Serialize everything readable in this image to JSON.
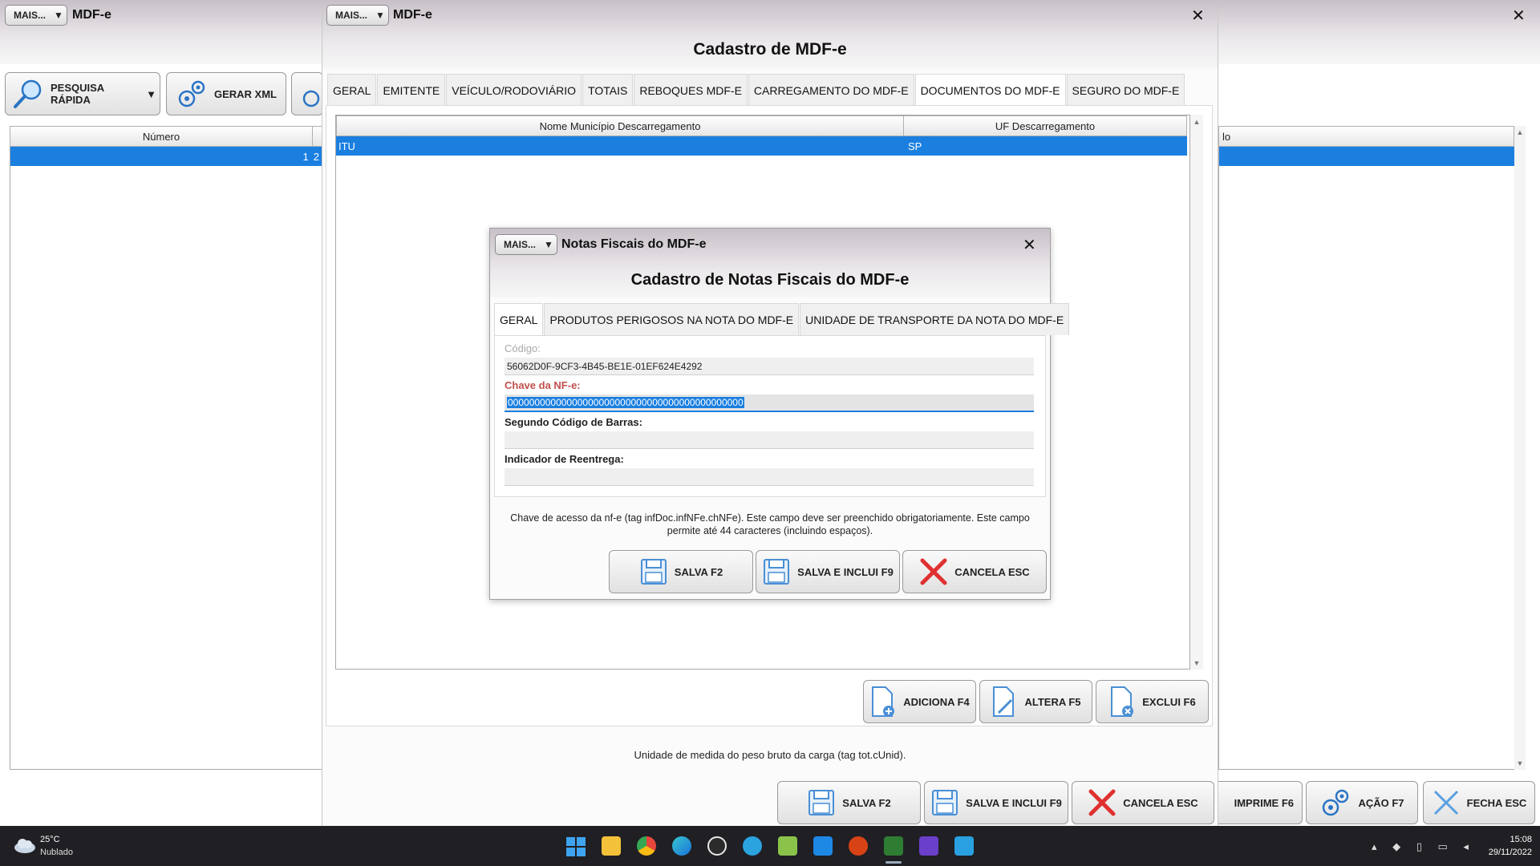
{
  "back_window": {
    "mais_label": "MAIS...",
    "title": "MDF-e",
    "buttons": {
      "pesquisa": "PESQUISA RÁPIDA",
      "gerar_xml": "GERAR XML",
      "imprime": "IMPRIME F6",
      "acao": "AÇÃO F7",
      "fecha": "FECHA ESC"
    },
    "grid": {
      "col_numero": "Número",
      "col_right_partial": "lo",
      "row_value": "1",
      "row_partial": "2"
    }
  },
  "main_window": {
    "mais_label": "MAIS...",
    "title": "MDF-e",
    "heading": "Cadastro de MDF-e",
    "tabs": [
      "GERAL",
      "EMITENTE",
      "VEÍCULO/RODOVIÁRIO",
      "TOTAIS",
      "REBOQUES MDF-E",
      "CARREGAMENTO DO MDF-E",
      "DOCUMENTOS DO MDF-E",
      "SEGURO DO MDF-E"
    ],
    "active_tab": "DOCUMENTOS DO MDF-E",
    "grid": {
      "col_municipio": "Nome Município Descarregamento",
      "col_uf": "UF Descarregamento",
      "row_municipio": "ITU",
      "row_uf": "SP"
    },
    "grid_buttons": {
      "adiciona": "ADICIONA F4",
      "altera": "ALTERA F5",
      "exclui": "EXCLUI F6"
    },
    "hint": "Unidade de medida do peso bruto da carga (tag tot.cUnid).",
    "buttons": {
      "salva": "SALVA F2",
      "salva_inclui": "SALVA E INCLUI F9",
      "cancela": "CANCELA ESC"
    }
  },
  "dialog": {
    "mais_label": "MAIS...",
    "title": "Notas Fiscais do MDF-e",
    "heading": "Cadastro de Notas Fiscais do MDF-e",
    "tabs": [
      "GERAL",
      "PRODUTOS PERIGOSOS NA NOTA DO MDF-E",
      "UNIDADE DE TRANSPORTE DA NOTA DO MDF-E"
    ],
    "fields": {
      "codigo_label": "Código:",
      "codigo_value": "56062D0F-9CF3-4B45-BE1E-01EF624E4292",
      "chave_label": "Chave da NF-e:",
      "chave_value": "00000000000000000000000000000000000000000000",
      "segundo_label": "Segundo Código de Barras:",
      "segundo_value": "",
      "indicador_label": "Indicador de Reentrega:",
      "indicador_value": ""
    },
    "hint": "Chave de acesso da nf-e (tag infDoc.infNFe.chNFe). Este campo deve ser preenchido obrigatoriamente. Este campo permite até 44 caracteres (incluindo espaços).",
    "buttons": {
      "salva": "SALVA F2",
      "salva_inclui": "SALVA E INCLUI F9",
      "cancela": "CANCELA ESC"
    }
  },
  "taskbar": {
    "weather_temp": "25°C",
    "weather_desc": "Nublado",
    "time": "15:08",
    "date": "29/11/2022"
  },
  "colors": {
    "selection": "#1b7fe0",
    "required_label": "#c0504d",
    "taskbar": "#1f1f24"
  }
}
